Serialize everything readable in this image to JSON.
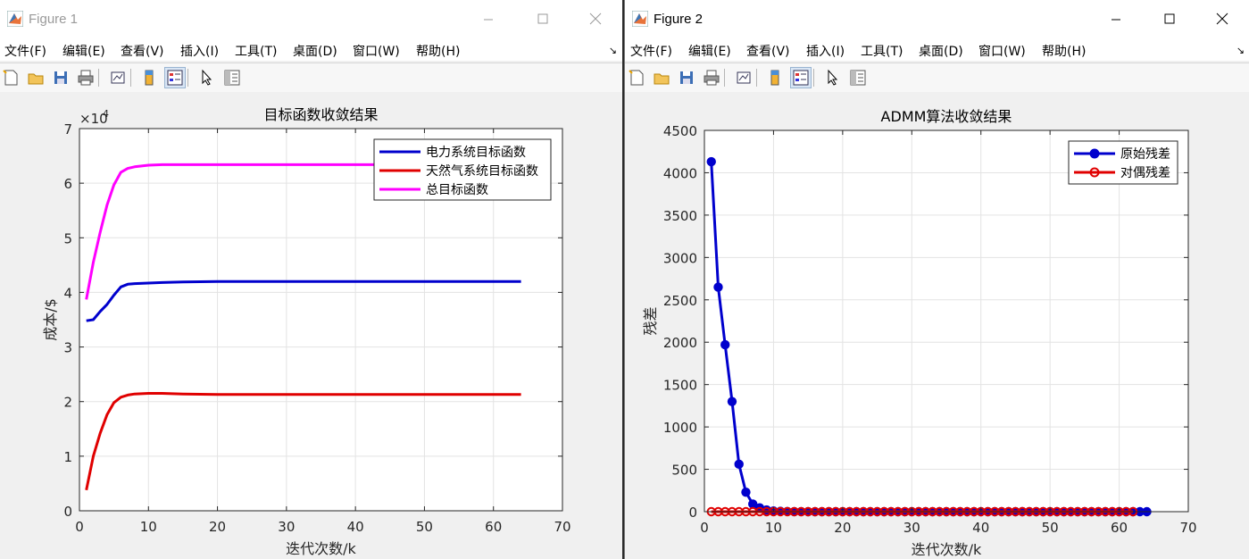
{
  "windows": [
    {
      "title": "Figure 1",
      "menu": [
        "文件(F)",
        "编辑(E)",
        "查看(V)",
        "插入(I)",
        "工具(T)",
        "桌面(D)",
        "窗口(W)",
        "帮助(H)"
      ],
      "toolbar_icons": [
        "new-figure-icon",
        "open-file-icon",
        "save-icon",
        "print-icon",
        "link-plot-icon",
        "colorbar-icon",
        "legend-icon",
        "pointer-icon",
        "property-editor-icon"
      ]
    },
    {
      "title": "Figure 2",
      "menu": [
        "文件(F)",
        "编辑(E)",
        "查看(V)",
        "插入(I)",
        "工具(T)",
        "桌面(D)",
        "窗口(W)",
        "帮助(H)"
      ],
      "toolbar_icons": [
        "new-figure-icon",
        "open-file-icon",
        "save-icon",
        "print-icon",
        "link-plot-icon",
        "colorbar-icon",
        "legend-icon",
        "pointer-icon",
        "property-editor-icon"
      ]
    }
  ],
  "colors": {
    "blue": "#0000cd",
    "red": "#e00000",
    "magenta": "#ff00ff",
    "grid": "#e3e3e3"
  },
  "chart_data": [
    {
      "type": "line",
      "title": "目标函数收敛结果",
      "xlabel": "迭代次数/k",
      "ylabel": "成本/$",
      "y_exponent_label": "×10",
      "y_exponent": "4",
      "xlim": [
        0,
        70
      ],
      "ylim": [
        0,
        7
      ],
      "xticks": [
        "0",
        "10",
        "20",
        "30",
        "40",
        "50",
        "60",
        "70"
      ],
      "yticks": [
        "0",
        "1",
        "2",
        "3",
        "4",
        "5",
        "6",
        "7"
      ],
      "grid": true,
      "legend_position": "top-right",
      "series": [
        {
          "name": "电力系统目标函数",
          "color": "#0000cd",
          "x": [
            1,
            2,
            3,
            4,
            5,
            6,
            7,
            8,
            10,
            12,
            15,
            20,
            30,
            40,
            50,
            60,
            64
          ],
          "y": [
            3.48,
            3.5,
            3.65,
            3.78,
            3.95,
            4.1,
            4.15,
            4.16,
            4.17,
            4.18,
            4.19,
            4.2,
            4.2,
            4.2,
            4.2,
            4.2,
            4.2
          ]
        },
        {
          "name": "天然气系统目标函数",
          "color": "#e00000",
          "x": [
            1,
            2,
            3,
            4,
            5,
            6,
            7,
            8,
            10,
            12,
            15,
            20,
            30,
            40,
            50,
            60,
            64
          ],
          "y": [
            0.38,
            1.0,
            1.42,
            1.76,
            1.98,
            2.08,
            2.12,
            2.14,
            2.15,
            2.15,
            2.14,
            2.13,
            2.13,
            2.13,
            2.13,
            2.13,
            2.13
          ]
        },
        {
          "name": "总目标函数",
          "color": "#ff00ff",
          "x": [
            1,
            2,
            3,
            4,
            5,
            6,
            7,
            8,
            10,
            12,
            15,
            20,
            30,
            40,
            50,
            60,
            64
          ],
          "y": [
            3.87,
            4.55,
            5.1,
            5.6,
            5.97,
            6.2,
            6.27,
            6.3,
            6.33,
            6.34,
            6.34,
            6.34,
            6.34,
            6.34,
            6.34,
            6.34,
            6.34
          ]
        }
      ]
    },
    {
      "type": "line",
      "title": "ADMM算法收敛结果",
      "xlabel": "迭代次数/k",
      "ylabel": "残差",
      "xlim": [
        0,
        70
      ],
      "ylim": [
        0,
        4500
      ],
      "xticks": [
        "0",
        "10",
        "20",
        "30",
        "40",
        "50",
        "60",
        "70"
      ],
      "yticks": [
        "0",
        "500",
        "1000",
        "1500",
        "2000",
        "2500",
        "3000",
        "3500",
        "4000",
        "4500"
      ],
      "grid": true,
      "legend_position": "top-right",
      "series": [
        {
          "name": "原始残差",
          "color": "#0000cd",
          "marker": "filled-circle",
          "x_start": 1,
          "x_end": 64,
          "values": [
            4130,
            2650,
            1970,
            1300,
            560,
            230,
            90,
            45,
            20,
            8,
            4,
            2,
            1,
            0.5
          ]
        },
        {
          "name": "对偶残差",
          "color": "#e00000",
          "marker": "open-circle",
          "x_start": 1,
          "x_end": 62,
          "values": [
            0
          ]
        }
      ]
    }
  ]
}
